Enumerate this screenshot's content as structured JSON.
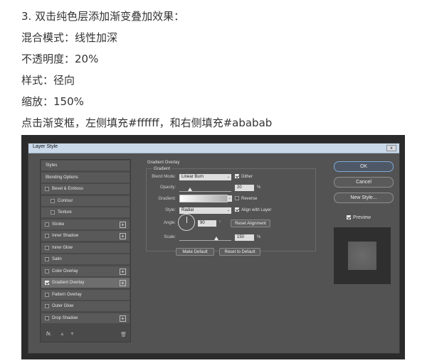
{
  "article": {
    "lines": [
      "3. 双击纯色层添加渐变叠加效果：",
      "混合模式：线性加深",
      "不透明度：20%",
      "样式：径向",
      "缩放：150%",
      "点击渐变框，左侧填充#ffffff，和右侧填充#ababab"
    ]
  },
  "dialog": {
    "title": "Layer Style",
    "close_label": "x",
    "sidebar": {
      "items": [
        {
          "label": "Styles",
          "checkbox": false,
          "checked": false,
          "plus": false,
          "selected": false
        },
        {
          "label": "Blending Options",
          "checkbox": false,
          "checked": false,
          "plus": false,
          "selected": false
        },
        {
          "label": "Bevel & Emboss",
          "checkbox": true,
          "checked": false,
          "plus": false,
          "selected": false
        },
        {
          "label": "Contour",
          "checkbox": true,
          "checked": false,
          "plus": false,
          "selected": false,
          "indent": true
        },
        {
          "label": "Texture",
          "checkbox": true,
          "checked": false,
          "plus": false,
          "selected": false,
          "indent": true
        },
        {
          "label": "Stroke",
          "checkbox": true,
          "checked": false,
          "plus": true,
          "selected": false
        },
        {
          "label": "Inner Shadow",
          "checkbox": true,
          "checked": false,
          "plus": true,
          "selected": false
        },
        {
          "label": "Inner Glow",
          "checkbox": true,
          "checked": false,
          "plus": false,
          "selected": false
        },
        {
          "label": "Satin",
          "checkbox": true,
          "checked": false,
          "plus": false,
          "selected": false
        },
        {
          "label": "Color Overlay",
          "checkbox": true,
          "checked": false,
          "plus": true,
          "selected": false
        },
        {
          "label": "Gradient Overlay",
          "checkbox": true,
          "checked": true,
          "plus": true,
          "selected": true
        },
        {
          "label": "Pattern Overlay",
          "checkbox": true,
          "checked": false,
          "plus": false,
          "selected": false
        },
        {
          "label": "Outer Glow",
          "checkbox": true,
          "checked": false,
          "plus": false,
          "selected": false
        },
        {
          "label": "Drop Shadow",
          "checkbox": true,
          "checked": false,
          "plus": true,
          "selected": false
        }
      ],
      "fx_label": "fx.",
      "up_icon": "arrow-up-icon",
      "down_icon": "arrow-down-icon",
      "trash_icon": "trash-icon"
    },
    "panel": {
      "section_title": "Gradient Overlay",
      "group_title": "Gradient",
      "blend_mode": {
        "label": "Blend Mode:",
        "value": "Linear Burn"
      },
      "dither": {
        "label": "Dither",
        "checked": true
      },
      "opacity": {
        "label": "Opacity:",
        "value": "20",
        "unit": "%",
        "level": 0.2
      },
      "gradient": {
        "label": "Gradient:",
        "colors": [
          "#ffffff",
          "#ababab"
        ]
      },
      "reverse": {
        "label": "Reverse",
        "checked": false
      },
      "style": {
        "label": "Style:",
        "value": "Radial"
      },
      "align": {
        "label": "Align with Layer",
        "checked": true
      },
      "angle": {
        "label": "Angle:",
        "value": "90",
        "unit": "°"
      },
      "reset_alignment": "Reset Alignment",
      "scale": {
        "label": "Scale:",
        "value": "150",
        "unit": "%",
        "level": 0.6
      },
      "make_default": "Make Default",
      "reset_default": "Reset to Default"
    },
    "right": {
      "ok": "OK",
      "cancel": "Cancel",
      "new_style": "New Style...",
      "preview_label": "Preview",
      "preview_checked": true
    }
  }
}
